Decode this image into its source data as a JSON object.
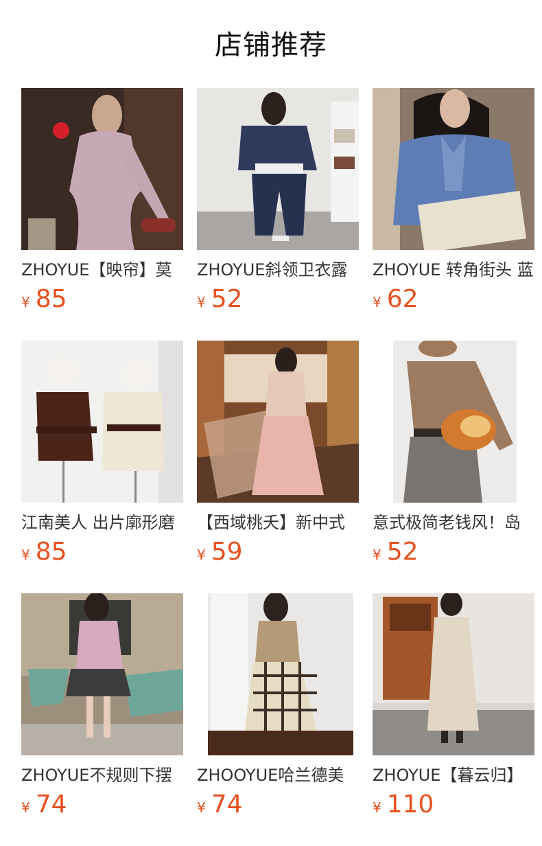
{
  "header": {
    "title": "店铺推荐"
  },
  "products": [
    {
      "title": "ZHOYUE【映帘】莫",
      "currency": "¥",
      "price": "85"
    },
    {
      "title": "ZHOYUE斜领卫衣露",
      "currency": "¥",
      "price": "52"
    },
    {
      "title": "ZHOYUE 转角街头 蓝",
      "currency": "¥",
      "price": "62"
    },
    {
      "title": "江南美人 出片廓形磨",
      "currency": "¥",
      "price": "85"
    },
    {
      "title": "【西域桃夭】新中式",
      "currency": "¥",
      "price": "59"
    },
    {
      "title": "意式极简老钱风！岛",
      "currency": "¥",
      "price": "52"
    },
    {
      "title": "ZHOYUE不规则下摆",
      "currency": "¥",
      "price": "74"
    },
    {
      "title": "ZHOOYUE哈兰德美",
      "currency": "¥",
      "price": "74"
    },
    {
      "title": "ZHOYUE【暮云归】",
      "currency": "¥",
      "price": "110"
    }
  ]
}
